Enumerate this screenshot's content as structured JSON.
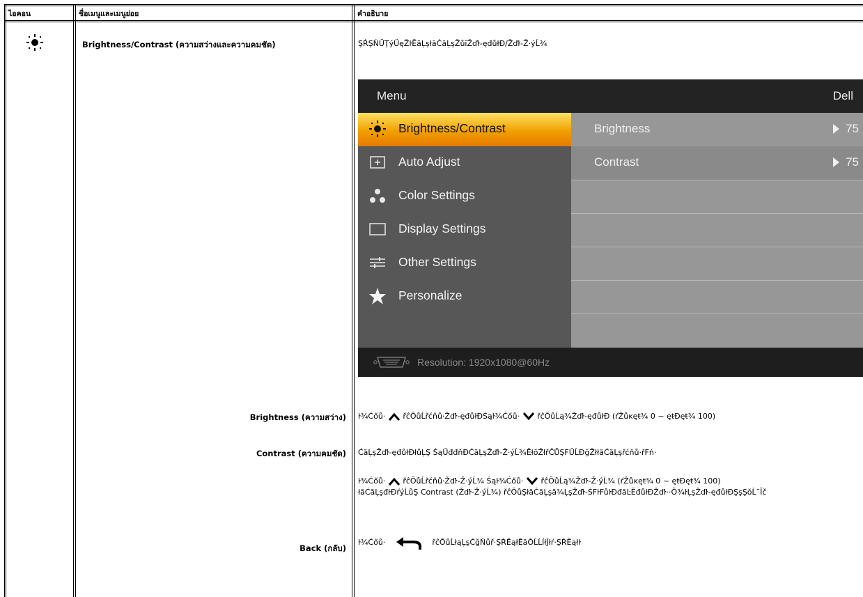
{
  "headers": {
    "icon": "ไอคอน",
    "menu": "ชื่อเมนูและเมนูย่อย",
    "desc": "คำอธิบาย"
  },
  "row_brightness_contrast": {
    "menu_label": "Brightness/Contrast (ความสว่างและความคมชัด)",
    "desc": "ŞŔŞŃŰŢýŰęŽŀĔăĻşłăĆăĻşŽůĭŽďŀ-ęđůłĐ/Žďŀ-Ž·ýĹ¾",
    "icon": "sun-icon"
  },
  "osd": {
    "title": "Menu",
    "brand": "Dell",
    "items": [
      {
        "label": "Brightness/Contrast",
        "icon": "sun-icon"
      },
      {
        "label": "Auto Adjust",
        "icon": "auto-adjust-icon"
      },
      {
        "label": "Color Settings",
        "icon": "color-dots-icon"
      },
      {
        "label": "Display Settings",
        "icon": "display-rect-icon"
      },
      {
        "label": "Other Settings",
        "icon": "sliders-icon"
      },
      {
        "label": "Personalize",
        "icon": "star-icon"
      }
    ],
    "sub": [
      {
        "label": "Brightness",
        "value": "75"
      },
      {
        "label": "Contrast",
        "value": "75"
      }
    ],
    "resolution": "Resolution:  1920x1080@60Hz"
  },
  "row_brightness": {
    "menu_label": "Brightness (ความสว่าง)",
    "desc_a": "ŀ¾Ćőů·",
    "desc_b": "řĉÕůĹřćňů·Žďŀ-ęđůłĐŚąŀ¾Ćőů·",
    "desc_c": "řĉÕůĹą¾Žďŀ-ęđůłĐ (ŕŽůĸęŧ¾ 0 ~ ęŧĐęŧ¾ 100)"
  },
  "row_contrast": {
    "menu_label": "Contrast (ความคมชัด)",
    "desc1": "ĆăĻşŽďŀ-ęđůłĐłůĻŞ ŚąŰđđňĐĆăĻşŽďŀ-Ž·ýĹ¾ĚłŏŽłřĈŮŞFŰĹĐğŽłłăĆăĻşřćňů·řFń·",
    "desc2_a": "ŀ¾Ćőů·",
    "desc2_b": "řĉÕůĹřćňů·Žďŀ-Ž·ýĹ¾ Śąŀ¾Ćőů·",
    "desc2_c": "řĉÕůĹą¾Žďŀ-Ž·ýĹ¾ (ŕŽůĸęŧ¾ 0 ~ ęŧĐęŧ¾ 100)",
    "desc3": "łăĆăĻşđŀĐŕýĹůŞ Contrast (Žďŀ-Ž·ýĹ¾) řĉÕůŞłăĆăĻşă¾ĻşŽďŀ-ŚFŀFůŀĐđăĿĔđůłĐŽďŀ··Õ¾ŀĻşŽďŀ-ęđůłĐŞşŞŏĹ¯Ĩč"
  },
  "row_back": {
    "menu_label": "Back (กลับ)",
    "desc_a": "ŀ¾Ćőů·",
    "desc_b": "řĉÕůĹłąĻşĆğŇůř·ŞŔĔąłĚăŎĹĹĺłĴłŕ·ŞŔĔąłŀ"
  }
}
